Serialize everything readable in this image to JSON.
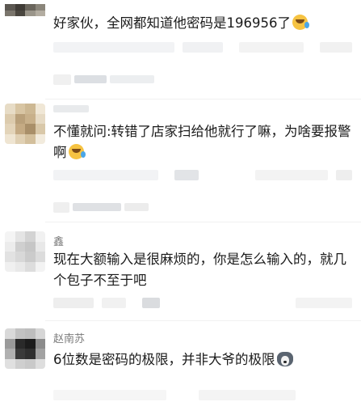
{
  "comments": [
    {
      "user": "",
      "text": "好家伙，全网都知道他密码是196956了",
      "emoji": "laughing-tears-icon"
    },
    {
      "user": "",
      "text": "不懂就问:转错了店家扫给他就行了嘛，为啥要报警啊",
      "emoji": "laughing-tears-icon"
    },
    {
      "user": "鑫",
      "text": "现在大额输入是很麻烦的，你是怎么输入的，就几个包子不至于吧",
      "emoji": ""
    },
    {
      "user": "赵南苏",
      "text": "6位数是密码的极限，并非大爷的极限",
      "emoji": "husky-icon"
    }
  ],
  "colors": {
    "text": "#1a1a1a",
    "username": "#7a7a7a",
    "blur": "#e8eaec"
  }
}
